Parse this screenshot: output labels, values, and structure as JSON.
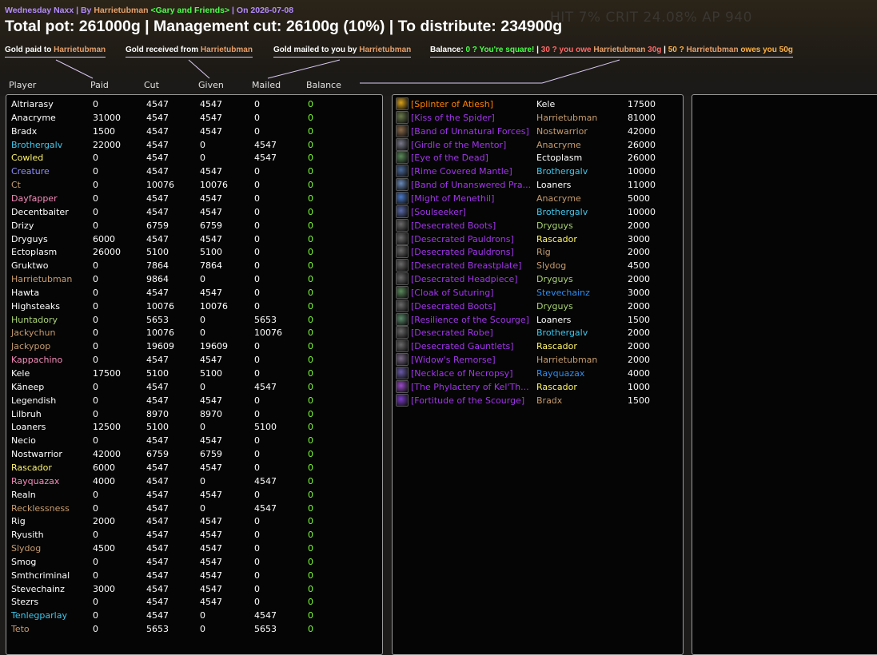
{
  "header": {
    "raid": "Wednesday Naxx",
    "sep1": " | By ",
    "author": "Harrietubman",
    "guild": " <Gary and Friends>",
    "date": " | On 2026-07-08"
  },
  "ghost_stats": "HIT 7%  CRIT 24.08%  AP 940",
  "totals": "Total pot: 261000g | Management cut: 26100g (10%) | To distribute: 234900g",
  "legend": {
    "paid": {
      "text": "Gold paid to ",
      "name": "Harrietubman"
    },
    "received": {
      "text": "Gold received from ",
      "name": "Harrietubman"
    },
    "mailed": {
      "text": "Gold mailed to you by ",
      "name": "Harrietubman"
    },
    "balance": {
      "label": "Balance: ",
      "square": "0 ? You're square!",
      "sep1": " | ",
      "owe_a": "30 ? you owe ",
      "owe_name": "Harrietubman",
      "owe_b": " 30g",
      "sep2": " | ",
      "owes_a": "50 ? ",
      "owes_name": "Harrietubman",
      "owes_b": " owes you 50g"
    }
  },
  "columns": [
    "Player",
    "Paid",
    "Cut",
    "Given",
    "Mailed",
    "Balance"
  ],
  "players": [
    {
      "name": "Altriarasy",
      "color": "#ffffff",
      "paid": "0",
      "cut": "4547",
      "given": "4547",
      "mailed": "0",
      "balance": "0"
    },
    {
      "name": "Anacryme",
      "color": "#ffffff",
      "paid": "31000",
      "cut": "4547",
      "given": "4547",
      "mailed": "0",
      "balance": "0"
    },
    {
      "name": "Bradx",
      "color": "#ffffff",
      "paid": "1500",
      "cut": "4547",
      "given": "4547",
      "mailed": "0",
      "balance": "0"
    },
    {
      "name": "Brothergalv",
      "color": "#40c7eb",
      "paid": "22000",
      "cut": "4547",
      "given": "0",
      "mailed": "4547",
      "balance": "0"
    },
    {
      "name": "Cowled",
      "color": "#fff569",
      "paid": "0",
      "cut": "4547",
      "given": "0",
      "mailed": "4547",
      "balance": "0"
    },
    {
      "name": "Creature",
      "color": "#8f8fff",
      "paid": "0",
      "cut": "4547",
      "given": "4547",
      "mailed": "0",
      "balance": "0"
    },
    {
      "name": "Ct",
      "color": "#c79c6e",
      "paid": "0",
      "cut": "10076",
      "given": "10076",
      "mailed": "0",
      "balance": "0"
    },
    {
      "name": "Dayfapper",
      "color": "#f58cba",
      "paid": "0",
      "cut": "4547",
      "given": "4547",
      "mailed": "0",
      "balance": "0"
    },
    {
      "name": "Decentbaiter",
      "color": "#ffffff",
      "paid": "0",
      "cut": "4547",
      "given": "4547",
      "mailed": "0",
      "balance": "0"
    },
    {
      "name": "Drizy",
      "color": "#ffffff",
      "paid": "0",
      "cut": "6759",
      "given": "6759",
      "mailed": "0",
      "balance": "0"
    },
    {
      "name": "Dryguys",
      "color": "#ffffff",
      "paid": "6000",
      "cut": "4547",
      "given": "4547",
      "mailed": "0",
      "balance": "0"
    },
    {
      "name": "Ectoplasm",
      "color": "#ffffff",
      "paid": "26000",
      "cut": "5100",
      "given": "5100",
      "mailed": "0",
      "balance": "0"
    },
    {
      "name": "Gruktwo",
      "color": "#ffffff",
      "paid": "0",
      "cut": "7864",
      "given": "7864",
      "mailed": "0",
      "balance": "0"
    },
    {
      "name": "Harrietubman",
      "color": "#c79c6e",
      "paid": "0",
      "cut": "9864",
      "given": "0",
      "mailed": "0",
      "balance": "0"
    },
    {
      "name": "Hawta",
      "color": "#ffffff",
      "paid": "0",
      "cut": "4547",
      "given": "4547",
      "mailed": "0",
      "balance": "0"
    },
    {
      "name": "Highsteaks",
      "color": "#ffffff",
      "paid": "0",
      "cut": "10076",
      "given": "10076",
      "mailed": "0",
      "balance": "0"
    },
    {
      "name": "Huntadory",
      "color": "#abd473",
      "paid": "0",
      "cut": "5653",
      "given": "0",
      "mailed": "5653",
      "balance": "0"
    },
    {
      "name": "Jackychun",
      "color": "#c79c6e",
      "paid": "0",
      "cut": "10076",
      "given": "0",
      "mailed": "10076",
      "balance": "0"
    },
    {
      "name": "Jackypop",
      "color": "#c79c6e",
      "paid": "0",
      "cut": "19609",
      "given": "19609",
      "mailed": "0",
      "balance": "0"
    },
    {
      "name": "Kappachino",
      "color": "#f58cba",
      "paid": "0",
      "cut": "4547",
      "given": "4547",
      "mailed": "0",
      "balance": "0"
    },
    {
      "name": "Kele",
      "color": "#ffffff",
      "paid": "17500",
      "cut": "5100",
      "given": "5100",
      "mailed": "0",
      "balance": "0"
    },
    {
      "name": "Käneep",
      "color": "#ffffff",
      "paid": "0",
      "cut": "4547",
      "given": "0",
      "mailed": "4547",
      "balance": "0"
    },
    {
      "name": "Legendish",
      "color": "#ffffff",
      "paid": "0",
      "cut": "4547",
      "given": "4547",
      "mailed": "0",
      "balance": "0"
    },
    {
      "name": "Lilbruh",
      "color": "#ffffff",
      "paid": "0",
      "cut": "8970",
      "given": "8970",
      "mailed": "0",
      "balance": "0"
    },
    {
      "name": "Loaners",
      "color": "#ffffff",
      "paid": "12500",
      "cut": "5100",
      "given": "0",
      "mailed": "5100",
      "balance": "0"
    },
    {
      "name": "Necio",
      "color": "#ffffff",
      "paid": "0",
      "cut": "4547",
      "given": "4547",
      "mailed": "0",
      "balance": "0"
    },
    {
      "name": "Nostwarrior",
      "color": "#ffffff",
      "paid": "42000",
      "cut": "6759",
      "given": "6759",
      "mailed": "0",
      "balance": "0"
    },
    {
      "name": "Rascador",
      "color": "#fff569",
      "paid": "6000",
      "cut": "4547",
      "given": "4547",
      "mailed": "0",
      "balance": "0"
    },
    {
      "name": "Rayquazax",
      "color": "#f58cba",
      "paid": "4000",
      "cut": "4547",
      "given": "0",
      "mailed": "4547",
      "balance": "0"
    },
    {
      "name": "Realn",
      "color": "#ffffff",
      "paid": "0",
      "cut": "4547",
      "given": "4547",
      "mailed": "0",
      "balance": "0"
    },
    {
      "name": "Recklessness",
      "color": "#c79c6e",
      "paid": "0",
      "cut": "4547",
      "given": "0",
      "mailed": "4547",
      "balance": "0"
    },
    {
      "name": "Rig",
      "color": "#ffffff",
      "paid": "2000",
      "cut": "4547",
      "given": "4547",
      "mailed": "0",
      "balance": "0"
    },
    {
      "name": "Ryusith",
      "color": "#ffffff",
      "paid": "0",
      "cut": "4547",
      "given": "4547",
      "mailed": "0",
      "balance": "0"
    },
    {
      "name": "Slydog",
      "color": "#c79c6e",
      "paid": "4500",
      "cut": "4547",
      "given": "4547",
      "mailed": "0",
      "balance": "0"
    },
    {
      "name": "Smog",
      "color": "#ffffff",
      "paid": "0",
      "cut": "4547",
      "given": "4547",
      "mailed": "0",
      "balance": "0"
    },
    {
      "name": "Smthcriminal",
      "color": "#ffffff",
      "paid": "0",
      "cut": "4547",
      "given": "4547",
      "mailed": "0",
      "balance": "0"
    },
    {
      "name": "Stevechainz",
      "color": "#ffffff",
      "paid": "3000",
      "cut": "4547",
      "given": "4547",
      "mailed": "0",
      "balance": "0"
    },
    {
      "name": "Stezrs",
      "color": "#ffffff",
      "paid": "0",
      "cut": "4547",
      "given": "4547",
      "mailed": "0",
      "balance": "0"
    },
    {
      "name": "Tenlegparlay",
      "color": "#40c7eb",
      "paid": "0",
      "cut": "4547",
      "given": "0",
      "mailed": "4547",
      "balance": "0"
    },
    {
      "name": "Teto",
      "color": "#c79c6e",
      "paid": "0",
      "cut": "5653",
      "given": "0",
      "mailed": "5653",
      "balance": "0"
    }
  ],
  "items": [
    {
      "item": "[Splinter of Atiesh]",
      "legendary": true,
      "icon": "splinter-icon",
      "icon_color": "#d9a21a",
      "winner": "Kele",
      "winner_color": "#ffffff",
      "price": "17500"
    },
    {
      "item": "[Kiss of the Spider]",
      "legendary": false,
      "icon": "spider-icon",
      "icon_color": "#6a7a4a",
      "winner": "Harrietubman",
      "winner_color": "#c79c6e",
      "price": "81000"
    },
    {
      "item": "[Band of Unnatural Forces]",
      "legendary": false,
      "icon": "ring-icon",
      "icon_color": "#8a6a4a",
      "winner": "Nostwarrior",
      "winner_color": "#c79c6e",
      "price": "42000"
    },
    {
      "item": "[Girdle of the Mentor]",
      "legendary": false,
      "icon": "belt-icon",
      "icon_color": "#7a7a8a",
      "winner": "Anacryme",
      "winner_color": "#c79c6e",
      "price": "26000"
    },
    {
      "item": "[Eye of the Dead]",
      "legendary": false,
      "icon": "eye-icon",
      "icon_color": "#5a8a5a",
      "winner": "Ectoplasm",
      "winner_color": "#ffffff",
      "price": "26000"
    },
    {
      "item": "[Rime Covered Mantle]",
      "legendary": false,
      "icon": "mantle-icon",
      "icon_color": "#4a6a9a",
      "winner": "Brothergalv",
      "winner_color": "#40c7eb",
      "price": "10000"
    },
    {
      "item": "[Band of Unanswered Pra...",
      "legendary": false,
      "icon": "ring-icon",
      "icon_color": "#6a8aba",
      "winner": "Loaners",
      "winner_color": "#ffffff",
      "price": "11000"
    },
    {
      "item": "[Might of Menethil]",
      "legendary": false,
      "icon": "mace-icon",
      "icon_color": "#4a7aca",
      "winner": "Anacryme",
      "winner_color": "#c79c6e",
      "price": "5000"
    },
    {
      "item": "[Soulseeker]",
      "legendary": false,
      "icon": "staff-icon",
      "icon_color": "#5a6aaa",
      "winner": "Brothergalv",
      "winner_color": "#40c7eb",
      "price": "10000"
    },
    {
      "item": "[Desecrated Boots]",
      "legendary": false,
      "icon": "boots-icon",
      "icon_color": "#6a6a6a",
      "winner": "Dryguys",
      "winner_color": "#abd473",
      "price": "2000"
    },
    {
      "item": "[Desecrated Pauldrons]",
      "legendary": false,
      "icon": "pauldrons-icon",
      "icon_color": "#6a6a6a",
      "winner": "Rascador",
      "winner_color": "#fff569",
      "price": "3000"
    },
    {
      "item": "[Desecrated Pauldrons]",
      "legendary": false,
      "icon": "pauldrons-icon",
      "icon_color": "#6a6a6a",
      "winner": "Rig",
      "winner_color": "#c79c6e",
      "price": "2000"
    },
    {
      "item": "[Desecrated Breastplate]",
      "legendary": false,
      "icon": "breastplate-icon",
      "icon_color": "#6a6a6a",
      "winner": "Slydog",
      "winner_color": "#c79c6e",
      "price": "4500"
    },
    {
      "item": "[Desecrated Headpiece]",
      "legendary": false,
      "icon": "headpiece-icon",
      "icon_color": "#6a6a6a",
      "winner": "Dryguys",
      "winner_color": "#abd473",
      "price": "2000"
    },
    {
      "item": "[Cloak of Suturing]",
      "legendary": false,
      "icon": "cloak-icon",
      "icon_color": "#5a8a5a",
      "winner": "Stevechainz",
      "winner_color": "#2f8ff0",
      "price": "3000"
    },
    {
      "item": "[Desecrated Boots]",
      "legendary": false,
      "icon": "boots-icon",
      "icon_color": "#6a6a6a",
      "winner": "Dryguys",
      "winner_color": "#abd473",
      "price": "2000"
    },
    {
      "item": "[Resilience of the Scourge]",
      "legendary": false,
      "icon": "scourge-icon",
      "icon_color": "#5a8a6a",
      "winner": "Loaners",
      "winner_color": "#ffffff",
      "price": "1500"
    },
    {
      "item": "[Desecrated Robe]",
      "legendary": false,
      "icon": "robe-icon",
      "icon_color": "#6a6a6a",
      "winner": "Brothergalv",
      "winner_color": "#40c7eb",
      "price": "2000"
    },
    {
      "item": "[Desecrated Gauntlets]",
      "legendary": false,
      "icon": "gauntlets-icon",
      "icon_color": "#6a6a6a",
      "winner": "Rascador",
      "winner_color": "#fff569",
      "price": "2000"
    },
    {
      "item": "[Widow's Remorse]",
      "legendary": false,
      "icon": "sword-icon",
      "icon_color": "#7a6a8a",
      "winner": "Harrietubman",
      "winner_color": "#c79c6e",
      "price": "2000"
    },
    {
      "item": "[Necklace of Necropsy]",
      "legendary": false,
      "icon": "necklace-icon",
      "icon_color": "#6a5aaa",
      "winner": "Rayquazax",
      "winner_color": "#2f8ff0",
      "price": "4000"
    },
    {
      "item": "[The Phylactery of Kel'Th...",
      "legendary": false,
      "icon": "phylactery-icon",
      "icon_color": "#9a4aca",
      "winner": "Rascador",
      "winner_color": "#fff569",
      "price": "1000"
    },
    {
      "item": "[Fortitude of the Scourge]",
      "legendary": false,
      "icon": "scourge-icon",
      "icon_color": "#7a3aca",
      "winner": "Bradx",
      "winner_color": "#c79c6e",
      "price": "1500"
    }
  ]
}
